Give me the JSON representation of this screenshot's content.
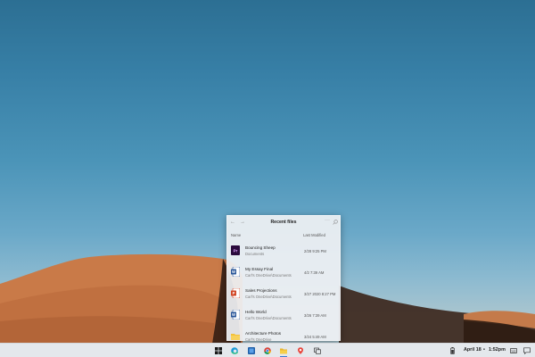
{
  "flyout": {
    "title": "Recent files",
    "back_icon": "arrow-left-icon",
    "forward_icon": "arrow-right-icon",
    "more_label": "···",
    "search_icon": "search-icon",
    "columns": {
      "name": "Name",
      "modified": "Last Modified"
    },
    "files": [
      {
        "name": "Bouncing Sheep",
        "location": "Documents",
        "modified": "2/28 9:25 PM",
        "icon": "premiere-file-icon",
        "color": "#2b0a3d"
      },
      {
        "name": "My Essay Final",
        "location": "Carl's OneDrive\\Documents",
        "modified": "4/2 7:39 AM",
        "icon": "word-file-icon",
        "color": "#2b579a"
      },
      {
        "name": "Sales Projections",
        "location": "Carl's OneDrive\\Documents",
        "modified": "3/27 2020 8:27 PM",
        "icon": "powerpoint-file-icon",
        "color": "#d24726"
      },
      {
        "name": "Hello World",
        "location": "Carl's OneDrive\\Documents",
        "modified": "3/26 7:39 AM",
        "icon": "word-file-icon",
        "color": "#2b579a"
      },
      {
        "name": "Architecture Photos",
        "location": "Carl's OneDrive",
        "modified": "3/24 5:49 AM",
        "icon": "folder-icon",
        "color": "#f3c13a"
      }
    ]
  },
  "taskbar": {
    "icons": [
      "windows-start-icon",
      "edge-browser-icon",
      "app-icon",
      "chrome-browser-icon",
      "file-explorer-icon",
      "maps-pin-icon",
      "task-view-icon"
    ],
    "tray": {
      "date": "April 18",
      "separator": "•",
      "time": "1:52pm"
    }
  },
  "colors": {
    "sky_top": "#2c6f93",
    "dune": "#c8794a",
    "taskbar": "#e4e8ec",
    "accent": "#3a7bd5"
  }
}
